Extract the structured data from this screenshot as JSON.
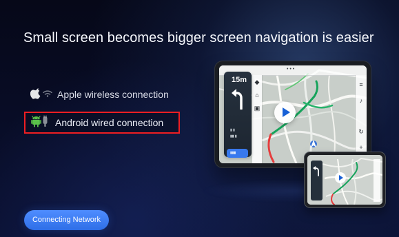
{
  "headline": "Small screen becomes bigger screen navigation is easier",
  "connection_options": [
    {
      "label": "Apple wireless connection",
      "icon": "apple-icon",
      "secondary_icon": "wifi-icon"
    },
    {
      "label": "Android wired connection",
      "icon": "android-icon",
      "secondary_icon": "cable-plug-icon",
      "selected": true
    }
  ],
  "connect_button_label": "Connecting Network",
  "navigation_preview": {
    "distance": "15m",
    "play_icon": "play-icon",
    "turn_icon": "left-turn-arrow-icon"
  },
  "colors": {
    "background": "#070a1d",
    "selection_border": "#ef1e22",
    "button": "#3879ee",
    "route_green": "#16a35b",
    "route_red": "#e53d3d",
    "android_green": "#5ac04a"
  }
}
